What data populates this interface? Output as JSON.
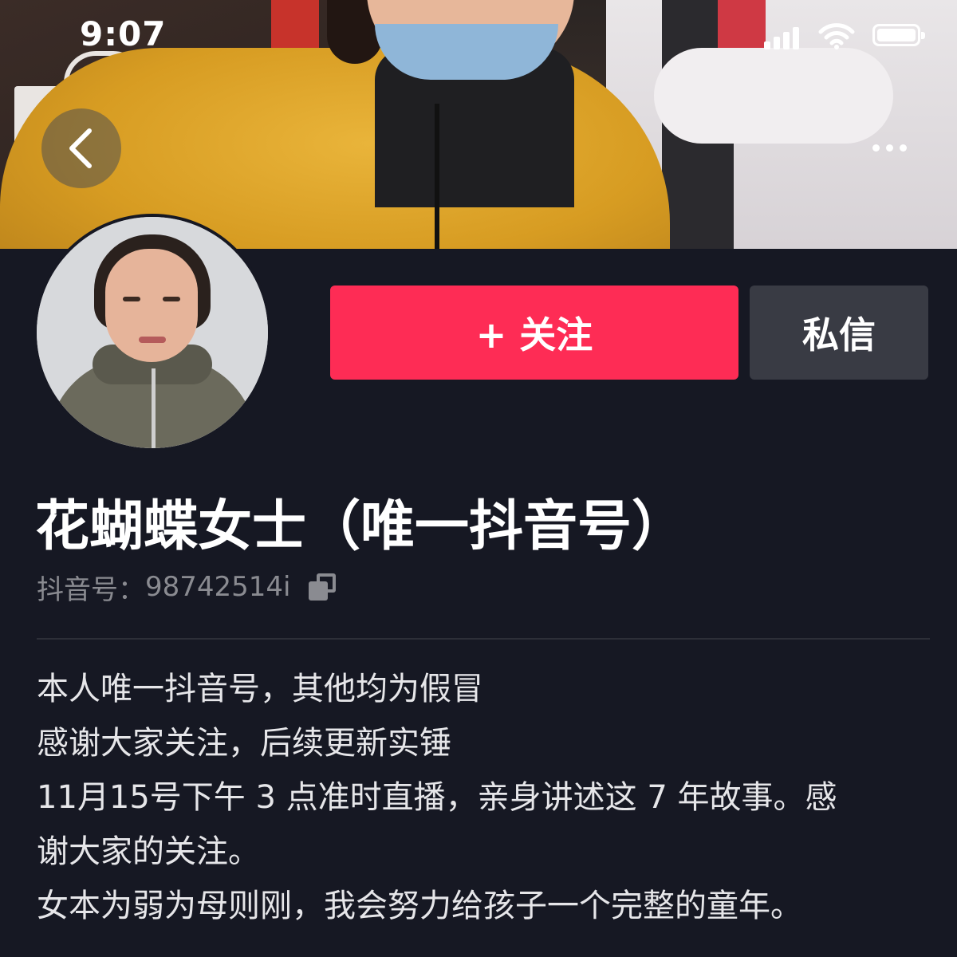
{
  "status_bar": {
    "time": "9:07"
  },
  "nav": {
    "back_icon": "chevron-left-icon",
    "more_icon": "more-horizontal-icon"
  },
  "profile": {
    "follow_button_label": "+ 关注",
    "message_button_label": "私信",
    "nickname": "花蝴蝶女士（唯一抖音号）",
    "account_label": "抖音号：",
    "account_id": "98742514i",
    "bio_lines": [
      "本人唯一抖音号，其他均为假冒",
      "感谢大家关注，后续更新实锤",
      "11月15号下午 3 点准时直播，亲身讲述这 7 年故事。感",
      "谢大家的关注。",
      "女本为弱为母则刚，我会努力给孩子一个完整的童年。"
    ]
  },
  "colors": {
    "background": "#161823",
    "follow_accent": "#fe2c55",
    "message_button": "#393b44",
    "secondary_text": "#8a8b91"
  }
}
